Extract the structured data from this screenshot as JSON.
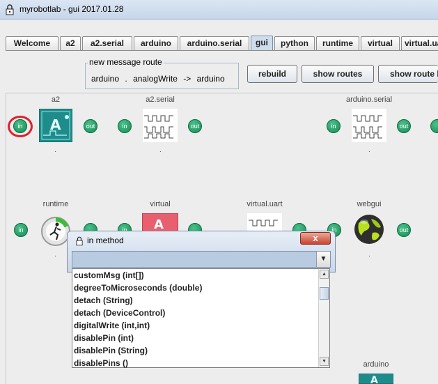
{
  "window": {
    "title": "myrobotlab - gui 2017.01.28"
  },
  "tabs": [
    {
      "label": "Welcome"
    },
    {
      "label": "a2"
    },
    {
      "label": "a2.serial"
    },
    {
      "label": "arduino"
    },
    {
      "label": "arduino.serial"
    },
    {
      "label": "gui"
    },
    {
      "label": "python"
    },
    {
      "label": "runtime"
    },
    {
      "label": "virtual"
    },
    {
      "label": "virtual.uar"
    }
  ],
  "route": {
    "legend": "new message route",
    "source": "arduino",
    "sep": ".",
    "method": "analogWrite",
    "arrow": "->",
    "target": "arduino"
  },
  "buttons": {
    "rebuild": "rebuild",
    "show_routes": "show routes",
    "show_route_l": "show route l"
  },
  "services": {
    "a2": {
      "name": "a2",
      "in": "in",
      "out": "out",
      "dot": "."
    },
    "a2_serial": {
      "name": "a2.serial",
      "in": "in",
      "out": "out",
      "dot": "."
    },
    "arduino_serial": {
      "name": "arduino.serial",
      "in": "in",
      "out": "out",
      "dot": "."
    },
    "runtime": {
      "name": "runtime",
      "in": "in",
      "dot": "."
    },
    "virtual": {
      "name": "virtual",
      "in": "in"
    },
    "virtual_uart": {
      "name": "virtual.uart"
    },
    "webgui": {
      "name": "webgui",
      "in": "in",
      "out": "out",
      "dot": "."
    },
    "arduino": {
      "name": "arduino"
    }
  },
  "dialog": {
    "title": "in method",
    "close": "x",
    "combo_value": "",
    "methods": [
      "customMsg (int[])",
      "degreeToMicroseconds (double)",
      "detach (String)",
      "detach (DeviceControl)",
      "digitalWrite (int,int)",
      "disablePin (int)",
      "disablePin (String)",
      "disablePins ()"
    ]
  }
}
